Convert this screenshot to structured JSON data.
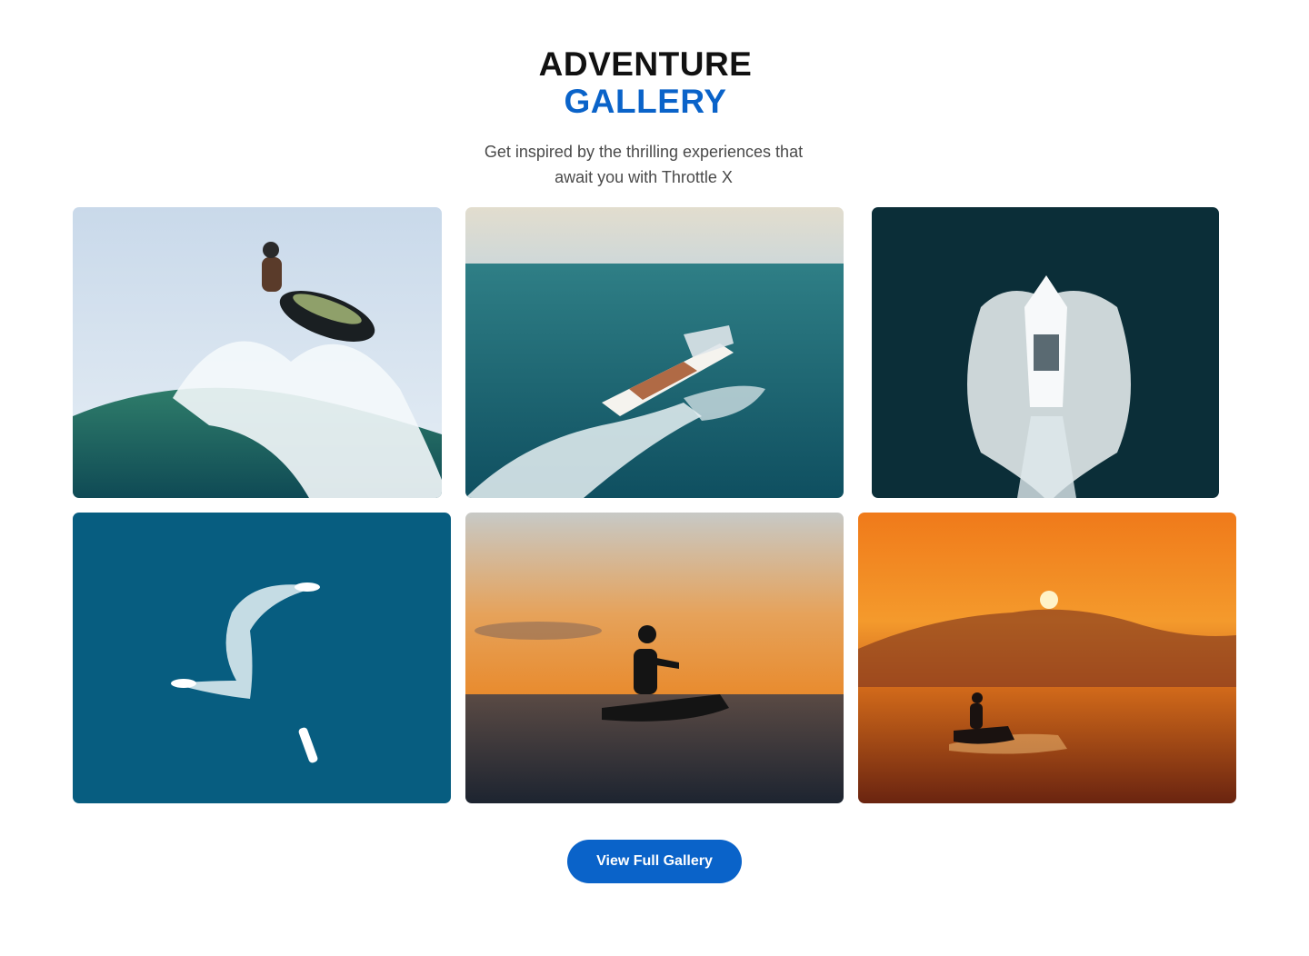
{
  "header": {
    "title_line1": "ADVENTURE",
    "title_line2": "GALLERY",
    "subtitle_line1": "Get inspired by the thrilling experiences that",
    "subtitle_line2": "await you with Throttle X"
  },
  "gallery": {
    "images": [
      {
        "subject": "jet ski jumping a wave"
      },
      {
        "subject": "speedboat on open sea"
      },
      {
        "subject": "aerial view of boat with wake"
      },
      {
        "subject": "aerial view of boats on blue water"
      },
      {
        "subject": "jet ski rider silhouette at sunset"
      },
      {
        "subject": "jet ski on orange sunset sea"
      }
    ]
  },
  "cta": {
    "label": "View Full Gallery"
  },
  "colors": {
    "accent": "#0a63c9",
    "title": "#111111",
    "subtitle": "#4a4a4a"
  }
}
